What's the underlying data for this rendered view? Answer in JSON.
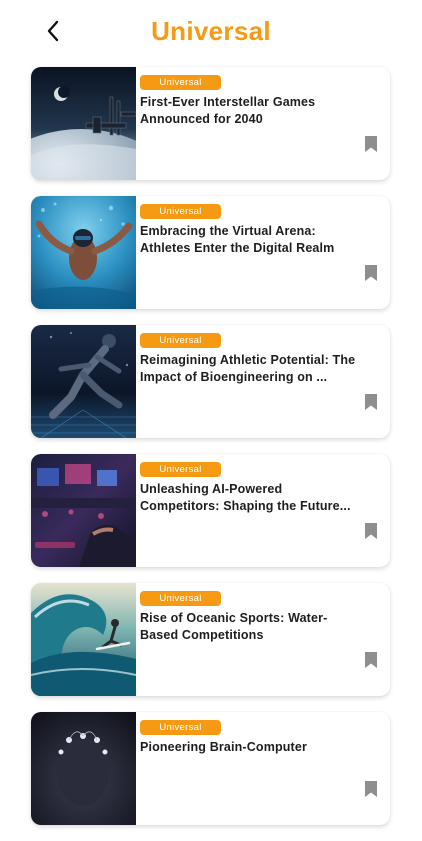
{
  "header": {
    "back_icon": "chevron-left-icon",
    "title": "Universal"
  },
  "colors": {
    "accent": "#F59A12",
    "title_text": "#1E1E1E",
    "bookmark": "#8E8E8E"
  },
  "articles": [
    {
      "category": "Universal",
      "title": "First-Ever Interstellar Games Announced for 2040",
      "bookmark_icon": "bookmark-icon"
    },
    {
      "category": "Universal",
      "title": "Embracing the Virtual Arena: Athletes Enter the Digital Realm",
      "bookmark_icon": "bookmark-icon"
    },
    {
      "category": "Universal",
      "title": "Reimagining Athletic Potential: The Impact of Bioengineering on ...",
      "bookmark_icon": "bookmark-icon"
    },
    {
      "category": "Universal",
      "title": "Unleashing AI-Powered Competitors: Shaping the Future...",
      "bookmark_icon": "bookmark-icon"
    },
    {
      "category": "Universal",
      "title": "Rise of Oceanic Sports: Water-Based Competitions",
      "bookmark_icon": "bookmark-icon"
    },
    {
      "category": "Universal",
      "title": "Pioneering Brain-Computer",
      "bookmark_icon": "bookmark-icon"
    }
  ]
}
